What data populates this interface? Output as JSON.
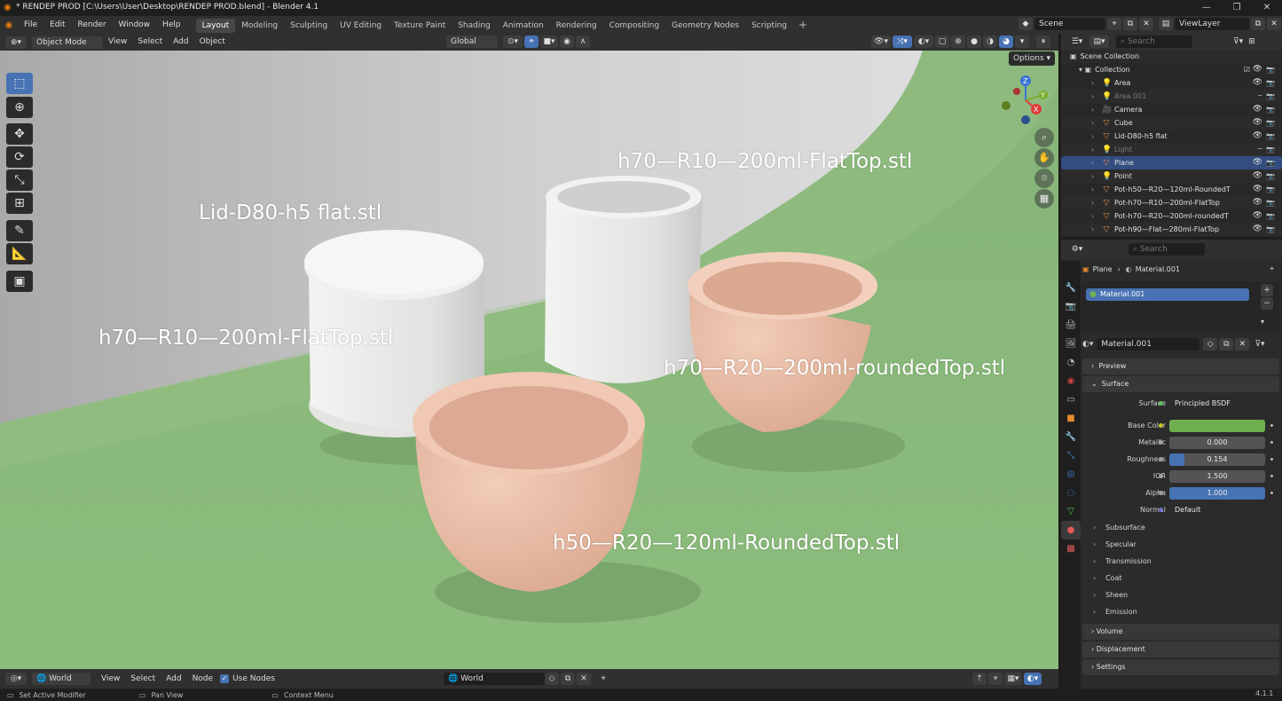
{
  "titlebar": {
    "title": "* RENDEP PROD [C:\\Users\\User\\Desktop\\RENDEP PROD.blend] - Blender 4.1",
    "min": "—",
    "max": "❐",
    "close": "✕"
  },
  "menu": {
    "items": [
      "File",
      "Edit",
      "Render",
      "Window",
      "Help"
    ]
  },
  "workspaces": [
    "Layout",
    "Modeling",
    "Sculpting",
    "UV Editing",
    "Texture Paint",
    "Shading",
    "Animation",
    "Rendering",
    "Compositing",
    "Geometry Nodes",
    "Scripting"
  ],
  "active_workspace": "Layout",
  "scene": {
    "scene_name": "Scene",
    "view_layer": "ViewLayer"
  },
  "viewport_header": {
    "mode": "Object Mode",
    "menus": [
      "View",
      "Select",
      "Add",
      "Object"
    ],
    "orientation": "Global",
    "options": "Options"
  },
  "gizmo": {
    "z": "Z",
    "y": "Y",
    "x": "X"
  },
  "viewport_labels": [
    "h70—R10—200ml-FlatTop.stl",
    "Lid-D80-h5 flat.stl",
    "h70—R10—200ml-FlatTop.stl",
    "h70—R20—200ml-roundedTop.stl",
    "h50—R20—120ml-RoundedTop.stl"
  ],
  "colors": {
    "accent": "#4772b3",
    "green_floor": "#8fbf7f",
    "pot_pink": "#e6b9a3",
    "pot_white": "#e6e6e4",
    "base_color_swatch": "#6fb04e"
  },
  "outliner": {
    "search_placeholder": "Search",
    "scene_collection": "Scene Collection",
    "collection": "Collection",
    "items": [
      {
        "name": "Area",
        "icon": "light-icon",
        "dim": false
      },
      {
        "name": "Area.001",
        "icon": "light-icon",
        "dim": true
      },
      {
        "name": "Camera",
        "icon": "camera-icon",
        "dim": false
      },
      {
        "name": "Cube",
        "icon": "mesh-icon",
        "dim": false
      },
      {
        "name": "Lid-D80-h5 flat",
        "icon": "mesh-icon",
        "dim": false
      },
      {
        "name": "Light",
        "icon": "light-icon",
        "dim": true
      },
      {
        "name": "Plane",
        "icon": "mesh-icon",
        "dim": false
      },
      {
        "name": "Point",
        "icon": "light-icon",
        "dim": false
      },
      {
        "name": "Pot-h50—R20—120ml-RoundedT",
        "icon": "mesh-icon",
        "dim": false
      },
      {
        "name": "Pot-h70—R10—200ml-FlatTop",
        "icon": "mesh-icon",
        "dim": false
      },
      {
        "name": "Pot-h70—R20—200ml-roundedT",
        "icon": "mesh-icon",
        "dim": false
      },
      {
        "name": "Pot-h90—Flat—280ml-FlatTop",
        "icon": "mesh-icon",
        "dim": false
      }
    ],
    "selected": "Plane"
  },
  "properties": {
    "search_placeholder": "Search",
    "breadcrumb_object": "Plane",
    "breadcrumb_material": "Material.001",
    "slot": "Material.001",
    "material_name": "Material.001",
    "panels": {
      "preview": "Preview",
      "surface": "Surface"
    },
    "surface_label": "Surface",
    "surface_value": "Principled BSDF",
    "fields": [
      {
        "label": "Base Color",
        "value": "",
        "fraction": 1.0
      },
      {
        "label": "Metallic",
        "value": "0.000",
        "fraction": 0.0
      },
      {
        "label": "Roughness",
        "value": "0.154",
        "fraction": 0.154
      },
      {
        "label": "IOR",
        "value": "1.500",
        "fraction": 0.0
      },
      {
        "label": "Alpha",
        "value": "1.000",
        "fraction": 1.0
      }
    ],
    "normal_label": "Normal",
    "normal_value": "Default",
    "subpanels": [
      "Subsurface",
      "Specular",
      "Transmission",
      "Coat",
      "Sheen",
      "Emission"
    ],
    "bottom_panels": [
      "Volume",
      "Displacement",
      "Settings"
    ]
  },
  "node_header": {
    "world_select": "World",
    "menus": [
      "View",
      "Select",
      "Add",
      "Node"
    ],
    "use_nodes": "Use Nodes",
    "world_field": "World"
  },
  "statusbar": {
    "left1": "Set Active Modifier",
    "left2": "Pan View",
    "left3": "Context Menu",
    "version": "4.1.1"
  }
}
